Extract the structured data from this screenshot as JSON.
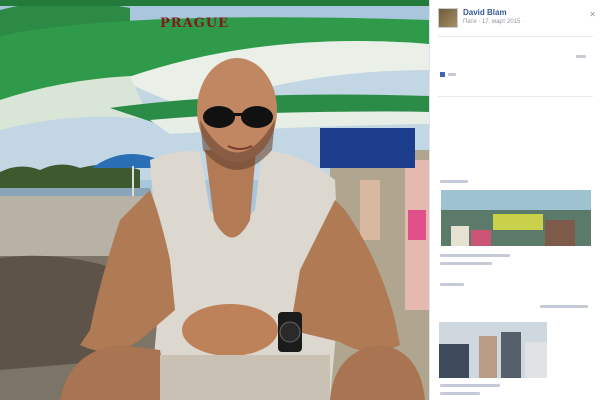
{
  "photo": {
    "umbrella_brand": "PRAGUE",
    "scene": "beach-bar-portrait"
  },
  "post": {
    "author": "David Blam",
    "meta": "Пати · 17. март 2015 ·"
  },
  "icons": {
    "close": "close-icon",
    "globe": "globe-icon"
  },
  "colors": {
    "link_blue": "#365899",
    "meta_gray": "#90949c",
    "sidebar_bg": "#ffffff"
  }
}
